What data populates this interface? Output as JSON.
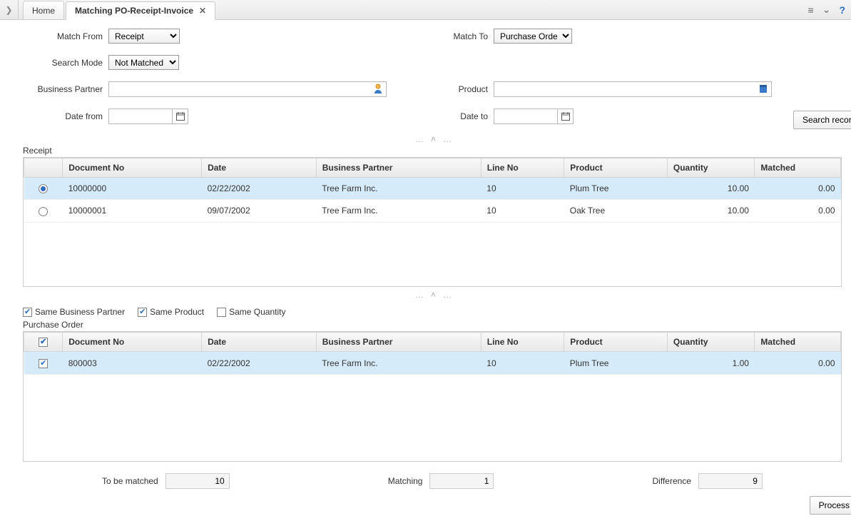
{
  "tabs": {
    "home": "Home",
    "active": "Matching PO-Receipt-Invoice"
  },
  "form": {
    "match_from_label": "Match From",
    "match_from_value": "Receipt",
    "match_to_label": "Match To",
    "match_to_value": "Purchase Order",
    "search_mode_label": "Search Mode",
    "search_mode_value": "Not Matched",
    "bpartner_label": "Business Partner",
    "product_label": "Product",
    "date_from_label": "Date from",
    "date_to_label": "Date to",
    "search_btn": "Search records"
  },
  "receipt": {
    "title": "Receipt",
    "headers": {
      "doc": "Document No",
      "date": "Date",
      "bp": "Business Partner",
      "line": "Line No",
      "product": "Product",
      "qty": "Quantity",
      "matched": "Matched"
    },
    "rows": [
      {
        "selected": true,
        "doc": "10000000",
        "date": "02/22/2002",
        "bp": "Tree Farm Inc.",
        "line": "10",
        "product": "Plum Tree",
        "qty": "10.00",
        "matched": "0.00"
      },
      {
        "selected": false,
        "doc": "10000001",
        "date": "09/07/2002",
        "bp": "Tree Farm Inc.",
        "line": "10",
        "product": "Oak Tree",
        "qty": "10.00",
        "matched": "0.00"
      }
    ]
  },
  "filters": {
    "same_bp": {
      "label": "Same Business Partner",
      "checked": true
    },
    "same_product": {
      "label": "Same Product",
      "checked": true
    },
    "same_qty": {
      "label": "Same Quantity",
      "checked": false
    }
  },
  "po": {
    "title": "Purchase Order",
    "headers": {
      "doc": "Document No",
      "date": "Date",
      "bp": "Business Partner",
      "line": "Line No",
      "product": "Product",
      "qty": "Quantity",
      "matched": "Matched"
    },
    "rows": [
      {
        "selected": true,
        "doc": "800003",
        "date": "02/22/2002",
        "bp": "Tree Farm Inc.",
        "line": "10",
        "product": "Plum Tree",
        "qty": "1.00",
        "matched": "0.00"
      }
    ]
  },
  "totals": {
    "to_be_matched_label": "To be matched",
    "to_be_matched": "10",
    "matching_label": "Matching",
    "matching": "1",
    "difference_label": "Difference",
    "difference": "9"
  },
  "process_btn": "Process"
}
